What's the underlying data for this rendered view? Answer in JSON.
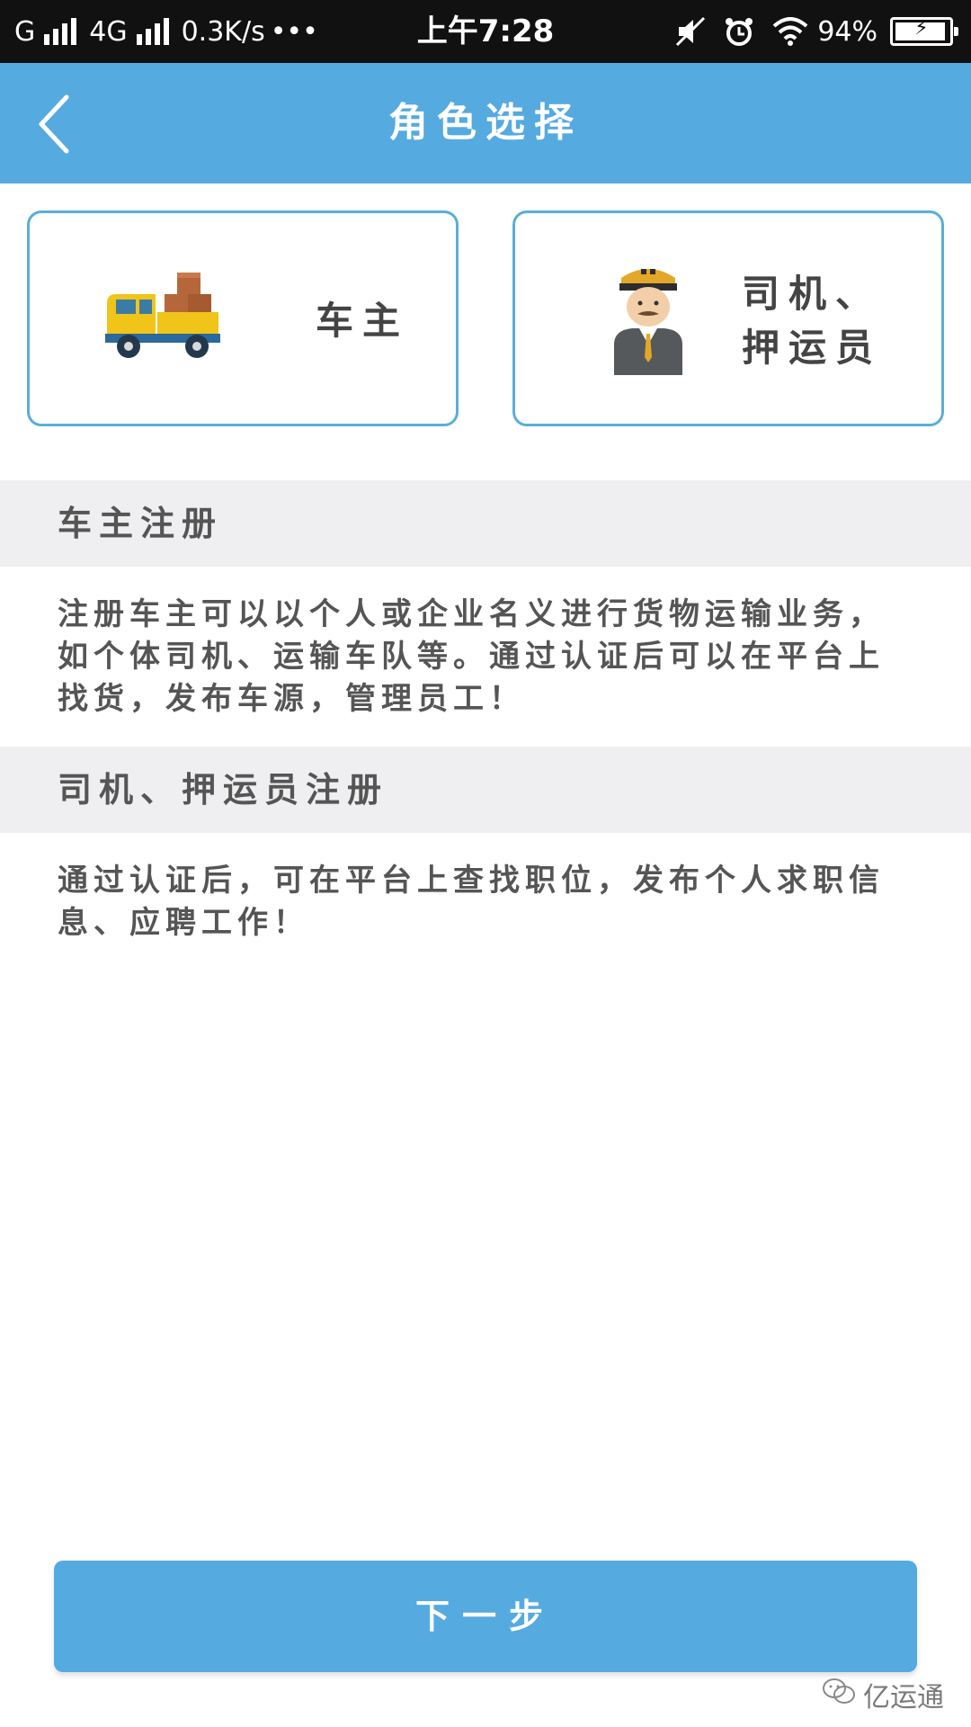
{
  "status_bar": {
    "carrier1": "G",
    "carrier2": "4G",
    "speed": "0.3K/s",
    "more": "•••",
    "time": "上午7:28",
    "battery": "94%",
    "battery_level": 0.94
  },
  "app_bar": {
    "title": "角色选择"
  },
  "roles": {
    "owner_label": "车主",
    "driver_label_line1": "司机、",
    "driver_label_line2": "押运员"
  },
  "sections": [
    {
      "title": "车主注册",
      "body": "注册车主可以以个人或企业名义进行货物运输业务，如个体司机、运输车队等。通过认证后可以在平台上找货，发布车源，管理员工！"
    },
    {
      "title": "司机、押运员注册",
      "body": "通过认证后，可在平台上查找职位，发布个人求职信息、应聘工作！"
    }
  ],
  "next_button": "下一步",
  "watermark": "亿运通",
  "colors": {
    "primary": "#55aae0",
    "card_border": "#5aaed8",
    "section_bg": "#efeff1"
  }
}
